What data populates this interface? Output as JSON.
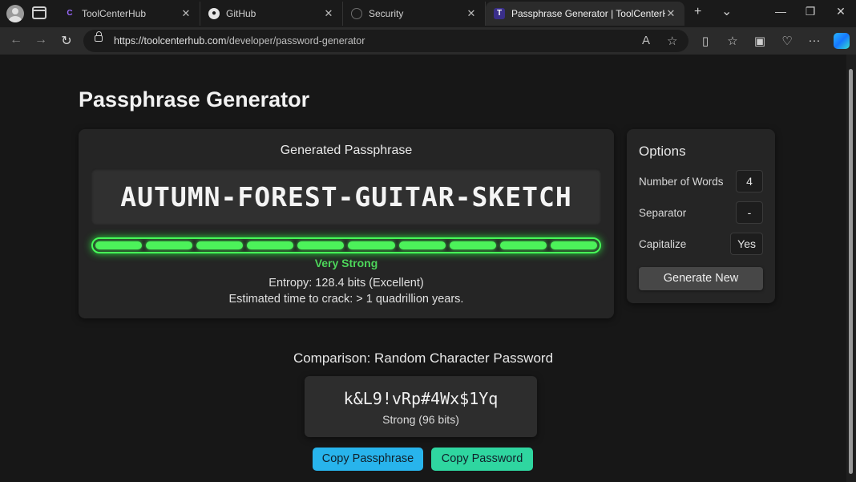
{
  "browser": {
    "tabs": [
      {
        "title": "ToolCenterHub",
        "favicon_color": "#8a5cf6"
      },
      {
        "title": "GitHub",
        "favicon_color": "#e6e6e6"
      },
      {
        "title": "Security",
        "favicon_color": "#6e6e6e"
      },
      {
        "title": "Passphrase Generator | ToolCenterHub.com",
        "favicon_color": "#6b5cf6"
      }
    ],
    "url_host": "https://toolcenterhub.com",
    "url_path": "/developer/password-generator",
    "icons": {
      "new_tab": "+",
      "tab_list": "⌄",
      "back": "←",
      "forward": "→",
      "refresh": "↻",
      "read_aloud": "A",
      "favorite": "☆",
      "split_screen": "▯",
      "favorites": "☆",
      "collections": "▣",
      "browser_essentials": "♡",
      "more": "···",
      "minimize": "—",
      "restore": "❐",
      "close": "✕"
    }
  },
  "page": {
    "title": "Passphrase Generator",
    "generated_heading": "Generated Passphrase",
    "passphrase": "AUTUMN-FOREST-GUITAR-SKETCH",
    "strength_segments": 10,
    "strength_filled": 10,
    "strength_label": "Very Strong",
    "entropy_text": "Entropy: 128.4 bits (Excellent)",
    "crack_text": "Estimated time to crack: > 1 quadrillion years.",
    "options": {
      "heading": "Options",
      "words_label": "Number of Words",
      "words_value": "4",
      "separator_label": "Separator",
      "separator_value": "-",
      "capitalize_label": "Capitalize",
      "capitalize_value": "Yes",
      "generate_label": "Generate New"
    },
    "comparison": {
      "heading": "Comparison: Random Character Password",
      "password": "k&L9!vRp#4Wx$1Yq",
      "strength": "Strong (96 bits)"
    },
    "copy_passphrase_label": "Copy Passphrase",
    "copy_password_label": "Copy Password"
  },
  "colors": {
    "meter_green": "#48ff5a",
    "copy_passphrase_bg": "#28b4ec",
    "copy_password_bg": "#2fd6a0"
  }
}
